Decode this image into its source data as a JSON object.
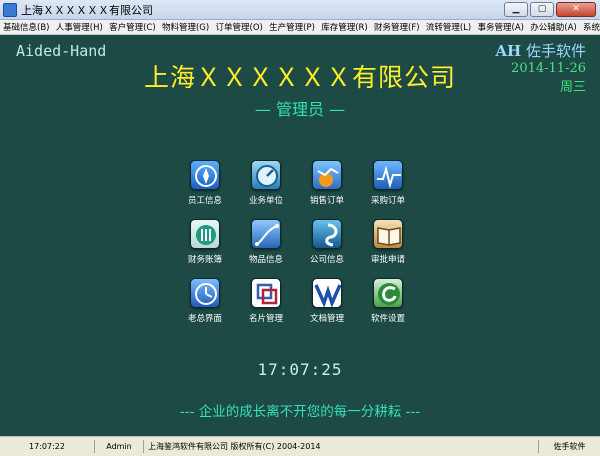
{
  "window": {
    "title": "上海ＸＸＸＸＸＸ有限公司"
  },
  "window_buttons": {
    "minimize": "▁",
    "maximize": "▢",
    "close": "✕"
  },
  "menu": [
    "基础信息(B)",
    "人事管理(H)",
    "客户管理(C)",
    "物料管理(G)",
    "订单管理(O)",
    "生产管理(P)",
    "库存管理(R)",
    "财务管理(F)",
    "流转管理(L)",
    "事务管理(A)",
    "办公辅助(A)",
    "系统管理(Y)"
  ],
  "header": {
    "product": "Aided-Hand",
    "company": "上海ＸＸＸＸＸＸ有限公司",
    "role": "— 管理员 —"
  },
  "brand": {
    "ah": "AH",
    "name": "佐手软件",
    "date": "2014-11-26",
    "weekday": "周三"
  },
  "icons": [
    {
      "label": "员工信息",
      "icon": "compass-icon",
      "color": "#1e6fd6"
    },
    {
      "label": "业务单位",
      "icon": "gauge-icon",
      "color": "#2a8fc2"
    },
    {
      "label": "销售订单",
      "icon": "chart-up-icon",
      "color": "#f08a1f"
    },
    {
      "label": "采购订单",
      "icon": "pulse-icon",
      "color": "#1a78c9"
    },
    {
      "label": "财务账簿",
      "icon": "coins-icon",
      "color": "#1c9a84"
    },
    {
      "label": "物品信息",
      "icon": "curve-icon",
      "color": "#1a7fd0"
    },
    {
      "label": "公司信息",
      "icon": "swirl-icon",
      "color": "#147fb8"
    },
    {
      "label": "审批申请",
      "icon": "book-icon",
      "color": "#b98a3e"
    },
    {
      "label": "老总界面",
      "icon": "clock-icon",
      "color": "#1f73d0"
    },
    {
      "label": "名片管理",
      "icon": "card-stack-icon",
      "color": "#ffffff"
    },
    {
      "label": "文档管理",
      "icon": "word-icon",
      "color": "#ffffff"
    },
    {
      "label": "软件设置",
      "icon": "cd-icon",
      "color": "#2a8a3a"
    }
  ],
  "clock": "17:07:25",
  "slogan": "--- 企业的成长离不开您的每一分耕耘 ---",
  "status": {
    "time": "17:07:22",
    "user": "Admin",
    "copyright": "上海鉴鸿软件有限公司 版权所有(C) 2004-2014",
    "brand": "佐手软件"
  }
}
